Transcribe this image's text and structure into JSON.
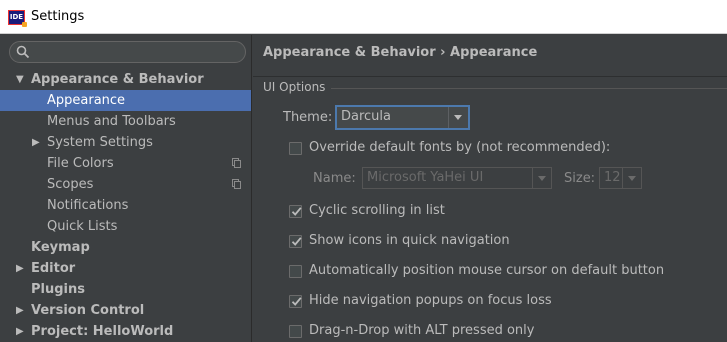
{
  "window": {
    "title": "Settings",
    "icon_text": "IDE"
  },
  "search": {
    "placeholder": ""
  },
  "tree": [
    {
      "label": "Appearance & Behavior",
      "bold": true,
      "arrow": "▼",
      "level": 0
    },
    {
      "label": "Appearance",
      "bold": false,
      "arrow": "",
      "level": 1,
      "selected": true
    },
    {
      "label": "Menus and Toolbars",
      "bold": false,
      "arrow": "",
      "level": 1
    },
    {
      "label": "System Settings",
      "bold": false,
      "arrow": "▶",
      "level": 1
    },
    {
      "label": "File Colors",
      "bold": false,
      "arrow": "",
      "level": 1,
      "copy_icon": true
    },
    {
      "label": "Scopes",
      "bold": false,
      "arrow": "",
      "level": 1,
      "copy_icon": true
    },
    {
      "label": "Notifications",
      "bold": false,
      "arrow": "",
      "level": 1
    },
    {
      "label": "Quick Lists",
      "bold": false,
      "arrow": "",
      "level": 1
    },
    {
      "label": "Keymap",
      "bold": true,
      "arrow": "",
      "level": 0
    },
    {
      "label": "Editor",
      "bold": true,
      "arrow": "▶",
      "level": 0
    },
    {
      "label": "Plugins",
      "bold": true,
      "arrow": "",
      "level": 0
    },
    {
      "label": "Version Control",
      "bold": true,
      "arrow": "▶",
      "level": 0
    },
    {
      "label": "Project: HelloWorld",
      "bold": true,
      "arrow": "▶",
      "level": 0
    }
  ],
  "content": {
    "breadcrumb": "Appearance & Behavior › Appearance",
    "section_title": "UI Options",
    "theme_label": "Theme:",
    "theme_value": "Darcula",
    "override_fonts_label": "Override default fonts by (not recommended):",
    "override_fonts_checked": false,
    "font_name_label": "Name:",
    "font_name_value": "Microsoft YaHei UI",
    "font_size_label": "Size:",
    "font_size_value": "12",
    "options": [
      {
        "label": "Cyclic scrolling in list",
        "checked": true
      },
      {
        "label": "Show icons in quick navigation",
        "checked": true
      },
      {
        "label": "Automatically position mouse cursor on default button",
        "checked": false
      },
      {
        "label": "Hide navigation popups on focus loss",
        "checked": true
      },
      {
        "label": "Drag-n-Drop with ALT pressed only",
        "checked": false
      }
    ]
  },
  "colors": {
    "background": "#3c3f41",
    "selection": "#4b6eaf",
    "focus_border": "#4c79ad"
  }
}
